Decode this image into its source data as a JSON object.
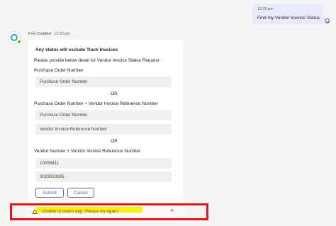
{
  "user_message": {
    "time": "12:20 pm",
    "text": "Find my Vendor Invoice Status"
  },
  "bot": {
    "name": "Finn ChatBot",
    "time": "12:20 pm"
  },
  "card": {
    "heading": "Any status will exclude Track Invoices",
    "instruction": "Please provide below detail for Vendor Invoice Status Request :",
    "option1_label": "Purchase Order Number",
    "option1_fields": [
      "Purchase Order Number"
    ],
    "or1": "OR",
    "option2_label": "Purchase Order Number + Vendor Invoice Reference Number",
    "option2_fields": [
      "Purchase Order Number",
      "Vendor Invoice Reference Number"
    ],
    "or2": "OR",
    "option3_label": "Vendor Number + Vendor Invoice Reference Number",
    "option3_fields": [
      "10059811",
      "3029019085"
    ],
    "submit_label": "Submit",
    "cancel_label": "Cancel"
  },
  "error": {
    "message": "Unable to reach app. Please try again.",
    "close_symbol": "×",
    "highlight_color": "#f7f200",
    "frame_color": "#e0131d"
  },
  "icons": {
    "sent": "sent-check-icon",
    "bot_avatar": "bot-avatar-icon",
    "warning": "warning-icon",
    "close": "close-icon"
  },
  "colors": {
    "accent": "#6264a7",
    "bubble": "#e8ebfa",
    "background": "#f5f5f5"
  }
}
